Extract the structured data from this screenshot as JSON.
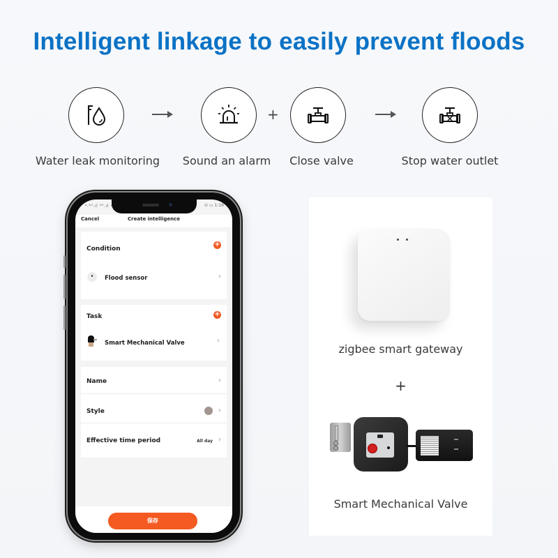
{
  "headline": "Intelligent linkage to easily prevent floods",
  "steps": [
    {
      "icon": "water-leak-sensor-icon",
      "label": "Water leak monitoring"
    },
    {
      "icon": "alarm-light-icon",
      "label": "Sound an alarm"
    },
    {
      "icon": "valve-icon",
      "label": "Close valve"
    },
    {
      "icon": "valve-closed-icon",
      "label": "Stop water outlet"
    }
  ],
  "connectors": [
    "→",
    "+",
    "→"
  ],
  "phone": {
    "status_bar": {
      "left": "ᵃ.⁴ᴳ.ıl ⁴ᴳ.ıl ᯤ",
      "right": "⊙ ▭ 1:19"
    },
    "header": {
      "cancel_label": "Cancel",
      "title": "Create intelligence"
    },
    "condition": {
      "label": "Condition",
      "add_icon": "+",
      "item": "Flood sensor"
    },
    "task": {
      "label": "Task",
      "add_icon": "+",
      "item": "Smart Mechanical Valve"
    },
    "settings": [
      {
        "label": "Name",
        "value": ""
      },
      {
        "label": "Style",
        "value": ""
      },
      {
        "label": "Effective time period",
        "value": "All day"
      }
    ],
    "style_color": "#a39590",
    "chevron": "›",
    "save_label": "保存",
    "accent": "#f45a22"
  },
  "products": {
    "gateway_caption": "zigbee smart gateway",
    "plus": "+",
    "valve_caption": "Smart Mechanical Valve"
  }
}
